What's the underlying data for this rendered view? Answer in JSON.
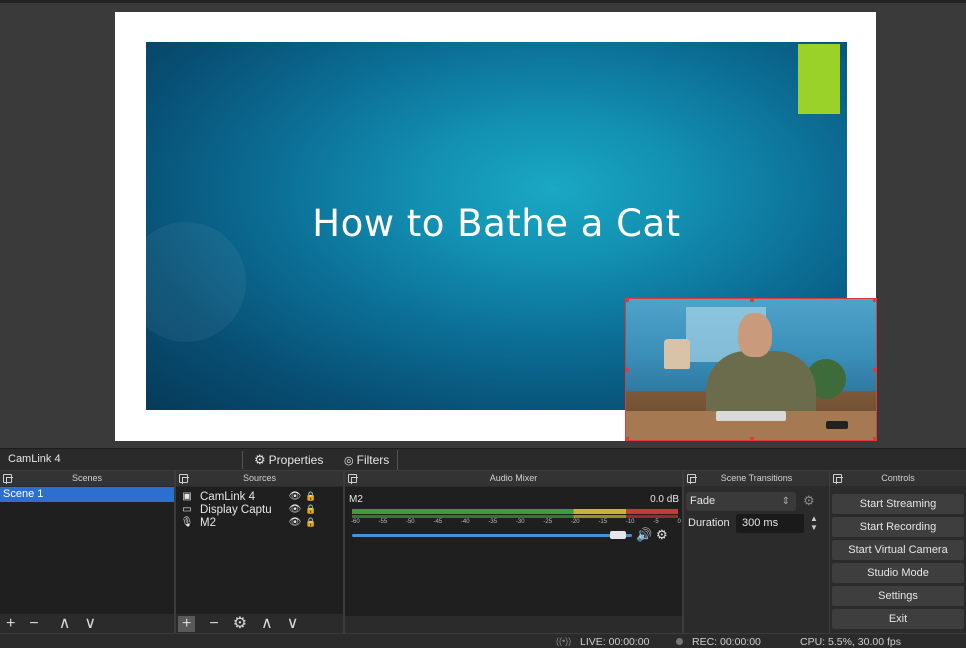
{
  "preview": {
    "slide_title": "How to Bathe a Cat"
  },
  "context_bar": {
    "source_name": "CamLink 4",
    "properties_label": "Properties",
    "filters_label": "Filters"
  },
  "docks": {
    "scenes": {
      "title": "Scenes",
      "items": [
        {
          "label": "Scene 1",
          "selected": true
        }
      ],
      "toolbar": [
        "+",
        "−",
        "∧",
        "∨"
      ]
    },
    "sources": {
      "title": "Sources",
      "items": [
        {
          "icon": "camera-icon",
          "label": "CamLink 4"
        },
        {
          "icon": "monitor-icon",
          "label": "Display Captu"
        },
        {
          "icon": "microphone-icon",
          "label": "M2"
        }
      ],
      "toolbar": [
        "+",
        "−",
        "⚙",
        "∧",
        "∨"
      ]
    },
    "audio_mixer": {
      "title": "Audio Mixer",
      "track_name": "M2",
      "level": "0.0 dB",
      "ticks": [
        "-60",
        "-55",
        "-50",
        "-45",
        "-40",
        "-35",
        "-30",
        "-25",
        "-20",
        "-15",
        "-10",
        "-5",
        "0"
      ],
      "volume": 0.95
    },
    "scene_transitions": {
      "title": "Scene Transitions",
      "transition": "Fade",
      "duration_label": "Duration",
      "duration_value": "300 ms"
    },
    "controls": {
      "title": "Controls",
      "buttons": [
        "Start Streaming",
        "Start Recording",
        "Start Virtual Camera",
        "Studio Mode",
        "Settings",
        "Exit"
      ]
    }
  },
  "status_bar": {
    "live": "LIVE: 00:00:00",
    "rec": "REC: 00:00:00",
    "cpu": "CPU: 5.5%, 30.00 fps"
  },
  "colors": {
    "selection": "#2d6fd1",
    "slide_accent": "#9bd22a",
    "webcam_border": "#e03a3a",
    "volume": "#4a90d9"
  }
}
